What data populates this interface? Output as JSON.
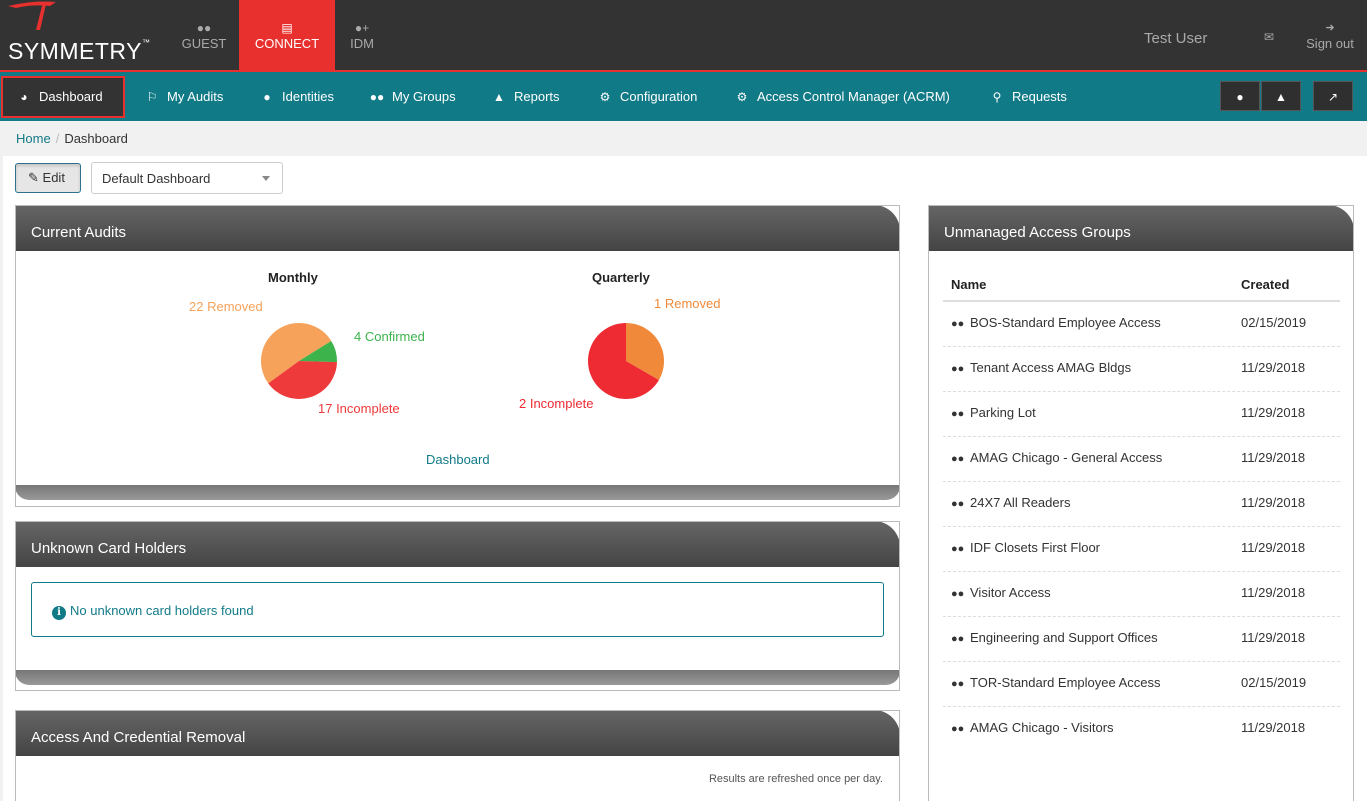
{
  "header": {
    "logo": "SYMMETRY",
    "logo_tm": "™",
    "apps": [
      {
        "label": "GUEST",
        "icon": "users-icon"
      },
      {
        "label": "CONNECT",
        "icon": "card-icon",
        "active": true
      },
      {
        "label": "IDM",
        "icon": "user-plus-icon"
      }
    ],
    "user": "Test User",
    "signout": "Sign out"
  },
  "nav": {
    "items": [
      {
        "label": "Dashboard",
        "icon": "dashboard-icon",
        "active": true
      },
      {
        "label": "My Audits",
        "icon": "flag-icon"
      },
      {
        "label": "Identities",
        "icon": "user-icon"
      },
      {
        "label": "My Groups",
        "icon": "users-icon"
      },
      {
        "label": "Reports",
        "icon": "area-chart-icon"
      },
      {
        "label": "Configuration",
        "icon": "gear-icon"
      },
      {
        "label": "Access Control Manager (ACRM)",
        "icon": "gear-icon"
      },
      {
        "label": "Requests",
        "icon": "key-icon"
      }
    ]
  },
  "breadcrumb": {
    "home": "Home",
    "separator": "/",
    "current": "Dashboard"
  },
  "toolbar": {
    "edit_label": "Edit",
    "dashboard_select": "Default Dashboard"
  },
  "current_audits": {
    "title": "Current Audits",
    "link": "Dashboard",
    "colors": {
      "removed": "#f7a25a",
      "confirmed": "#3cb44b",
      "incomplete": "#ee3a3a",
      "q_removed": "#f08a3a",
      "q_incomplete": "#ee2a33"
    },
    "chart_data": [
      {
        "type": "pie",
        "title": "Monthly",
        "labels": [
          "Removed",
          "Confirmed",
          "Incomplete"
        ],
        "values": [
          22,
          4,
          17
        ],
        "display_labels": [
          "22 Removed",
          "4 Confirmed",
          "17 Incomplete"
        ]
      },
      {
        "type": "pie",
        "title": "Quarterly",
        "labels": [
          "Removed",
          "Incomplete"
        ],
        "values": [
          1,
          2
        ],
        "display_labels": [
          "1 Removed",
          "2 Incomplete"
        ]
      }
    ]
  },
  "unknown_card_holders": {
    "title": "Unknown Card Holders",
    "message": "No unknown card holders found"
  },
  "access_removal": {
    "title": "Access And Credential Removal",
    "note": "Results are refreshed once per day."
  },
  "unmanaged_groups": {
    "title": "Unmanaged Access Groups",
    "columns": [
      "Name",
      "Created"
    ],
    "rows": [
      {
        "name": "BOS-Standard Employee Access",
        "created": "02/15/2019"
      },
      {
        "name": "Tenant Access AMAG Bldgs",
        "created": "11/29/2018"
      },
      {
        "name": "Parking Lot",
        "created": "11/29/2018"
      },
      {
        "name": "AMAG Chicago - General Access",
        "created": "11/29/2018"
      },
      {
        "name": "24X7 All Readers",
        "created": "11/29/2018"
      },
      {
        "name": "IDF Closets First Floor",
        "created": "11/29/2018"
      },
      {
        "name": "Visitor Access",
        "created": "11/29/2018"
      },
      {
        "name": "Engineering and Support Offices",
        "created": "11/29/2018"
      },
      {
        "name": "TOR-Standard Employee Access",
        "created": "02/15/2019"
      },
      {
        "name": "AMAG Chicago - Visitors",
        "created": "11/29/2018"
      }
    ]
  }
}
